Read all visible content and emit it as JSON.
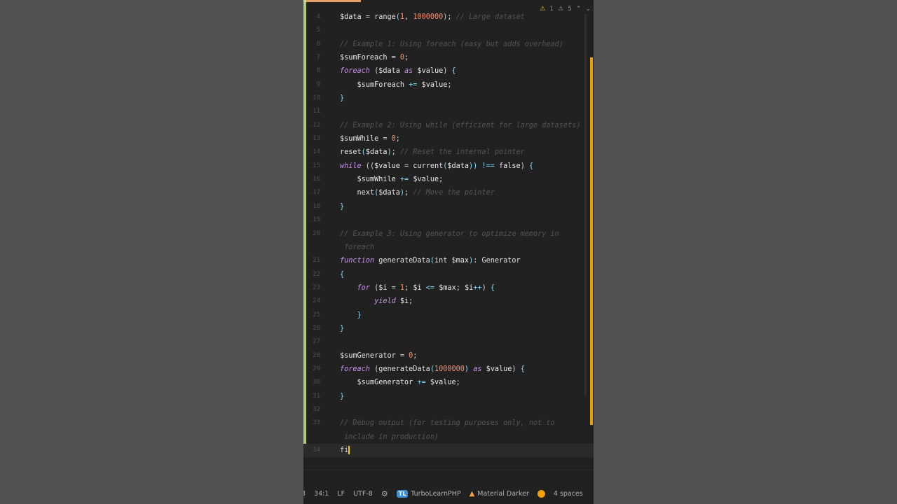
{
  "inspection": {
    "warnings": "1",
    "weak_warnings": "5",
    "up_arrow": "⌃",
    "down_arrow": "⌄"
  },
  "code_lines": [
    {
      "n": "4",
      "tokens": [
        [
          "var",
          "$data"
        ],
        [
          "plain",
          " = "
        ],
        [
          "fn",
          "range"
        ],
        [
          "punc",
          "("
        ],
        [
          "num",
          "1"
        ],
        [
          "plain",
          ", "
        ],
        [
          "num",
          "1000000"
        ],
        [
          "punc",
          ")"
        ],
        [
          "plain",
          "; "
        ],
        [
          "cm",
          "// Large dataset"
        ]
      ]
    },
    {
      "n": "5",
      "tokens": []
    },
    {
      "n": "6",
      "tokens": [
        [
          "cm",
          "// Example 1: Using foreach (easy but adds overhead)"
        ]
      ]
    },
    {
      "n": "7",
      "tokens": [
        [
          "var",
          "$sumForeach"
        ],
        [
          "plain",
          " = "
        ],
        [
          "num",
          "0"
        ],
        [
          "plain",
          ";"
        ]
      ]
    },
    {
      "n": "8",
      "tokens": [
        [
          "kw",
          "foreach"
        ],
        [
          "plain",
          " ("
        ],
        [
          "var",
          "$data"
        ],
        [
          "plain",
          " "
        ],
        [
          "kw",
          "as"
        ],
        [
          "plain",
          " "
        ],
        [
          "var",
          "$value"
        ],
        [
          "plain",
          ") "
        ],
        [
          "punc",
          "{"
        ]
      ]
    },
    {
      "n": "9",
      "tokens": [
        [
          "plain",
          "    "
        ],
        [
          "var",
          "$sumForeach"
        ],
        [
          "plain",
          " "
        ],
        [
          "op",
          "+="
        ],
        [
          "plain",
          " "
        ],
        [
          "var",
          "$value"
        ],
        [
          "plain",
          ";"
        ]
      ]
    },
    {
      "n": "10",
      "tokens": [
        [
          "punc",
          "}"
        ]
      ]
    },
    {
      "n": "11",
      "tokens": []
    },
    {
      "n": "12",
      "tokens": [
        [
          "cm",
          "// Example 2: Using while (efficient for large datasets)"
        ]
      ]
    },
    {
      "n": "13",
      "tokens": [
        [
          "var",
          "$sumWhile"
        ],
        [
          "plain",
          " = "
        ],
        [
          "num",
          "0"
        ],
        [
          "plain",
          ";"
        ]
      ]
    },
    {
      "n": "14",
      "tokens": [
        [
          "fn",
          "reset"
        ],
        [
          "punc",
          "("
        ],
        [
          "var",
          "$data"
        ],
        [
          "punc",
          ")"
        ],
        [
          "plain",
          "; "
        ],
        [
          "cm",
          "// Reset the internal pointer"
        ]
      ]
    },
    {
      "n": "15",
      "tokens": [
        [
          "kw",
          "while"
        ],
        [
          "plain",
          " (("
        ],
        [
          "var",
          "$value"
        ],
        [
          "plain",
          " = "
        ],
        [
          "fn",
          "current"
        ],
        [
          "punc",
          "("
        ],
        [
          "var",
          "$data"
        ],
        [
          "punc",
          "))"
        ],
        [
          "plain",
          " "
        ],
        [
          "op",
          "!=="
        ],
        [
          "plain",
          " "
        ],
        [
          "bool",
          "false"
        ],
        [
          "plain",
          ") "
        ],
        [
          "punc",
          "{"
        ]
      ]
    },
    {
      "n": "16",
      "tokens": [
        [
          "plain",
          "    "
        ],
        [
          "var",
          "$sumWhile"
        ],
        [
          "plain",
          " "
        ],
        [
          "op",
          "+="
        ],
        [
          "plain",
          " "
        ],
        [
          "var",
          "$value"
        ],
        [
          "plain",
          ";"
        ]
      ]
    },
    {
      "n": "17",
      "tokens": [
        [
          "plain",
          "    "
        ],
        [
          "fn",
          "next"
        ],
        [
          "punc",
          "("
        ],
        [
          "var",
          "$data"
        ],
        [
          "punc",
          ")"
        ],
        [
          "plain",
          "; "
        ],
        [
          "cm",
          "// Move the pointer"
        ]
      ]
    },
    {
      "n": "18",
      "tokens": [
        [
          "punc",
          "}"
        ]
      ]
    },
    {
      "n": "19",
      "tokens": []
    },
    {
      "n": "20",
      "tokens": [
        [
          "cm",
          "// Example 3: Using generator to optimize memory in"
        ]
      ]
    },
    {
      "n": "",
      "tokens": [
        [
          "cm",
          " foreach"
        ]
      ]
    },
    {
      "n": "21",
      "tokens": [
        [
          "kw",
          "function"
        ],
        [
          "plain",
          " "
        ],
        [
          "fn",
          "generateData"
        ],
        [
          "punc",
          "("
        ],
        [
          "ty",
          "int"
        ],
        [
          "plain",
          " "
        ],
        [
          "var",
          "$max"
        ],
        [
          "punc",
          ")"
        ],
        [
          "plain",
          ": "
        ],
        [
          "ty",
          "Generator"
        ]
      ]
    },
    {
      "n": "22",
      "tokens": [
        [
          "punc",
          "{"
        ]
      ]
    },
    {
      "n": "23",
      "tokens": [
        [
          "plain",
          "    "
        ],
        [
          "kw",
          "for"
        ],
        [
          "plain",
          " ("
        ],
        [
          "var",
          "$i"
        ],
        [
          "plain",
          " = "
        ],
        [
          "num",
          "1"
        ],
        [
          "plain",
          "; "
        ],
        [
          "var",
          "$i"
        ],
        [
          "plain",
          " "
        ],
        [
          "op",
          "<="
        ],
        [
          "plain",
          " "
        ],
        [
          "var",
          "$max"
        ],
        [
          "plain",
          "; "
        ],
        [
          "var",
          "$i"
        ],
        [
          "op",
          "++"
        ],
        [
          "plain",
          ") "
        ],
        [
          "punc",
          "{"
        ]
      ]
    },
    {
      "n": "24",
      "tokens": [
        [
          "plain",
          "        "
        ],
        [
          "kw",
          "yield"
        ],
        [
          "plain",
          " "
        ],
        [
          "var",
          "$i"
        ],
        [
          "plain",
          ";"
        ]
      ]
    },
    {
      "n": "25",
      "tokens": [
        [
          "plain",
          "    "
        ],
        [
          "punc",
          "}"
        ]
      ]
    },
    {
      "n": "26",
      "tokens": [
        [
          "punc",
          "}"
        ]
      ]
    },
    {
      "n": "27",
      "tokens": []
    },
    {
      "n": "28",
      "tokens": [
        [
          "var",
          "$sumGenerator"
        ],
        [
          "plain",
          " = "
        ],
        [
          "num",
          "0"
        ],
        [
          "plain",
          ";"
        ]
      ]
    },
    {
      "n": "29",
      "tokens": [
        [
          "kw",
          "foreach"
        ],
        [
          "plain",
          " ("
        ],
        [
          "fn",
          "generateData"
        ],
        [
          "punc",
          "("
        ],
        [
          "num",
          "1000000"
        ],
        [
          "punc",
          ")"
        ],
        [
          "plain",
          " "
        ],
        [
          "kw",
          "as"
        ],
        [
          "plain",
          " "
        ],
        [
          "var",
          "$value"
        ],
        [
          "plain",
          ") "
        ],
        [
          "punc",
          "{"
        ]
      ]
    },
    {
      "n": "30",
      "tokens": [
        [
          "plain",
          "    "
        ],
        [
          "var",
          "$sumGenerator"
        ],
        [
          "plain",
          " "
        ],
        [
          "op",
          "+="
        ],
        [
          "plain",
          " "
        ],
        [
          "var",
          "$value"
        ],
        [
          "plain",
          ";"
        ]
      ]
    },
    {
      "n": "31",
      "tokens": [
        [
          "punc",
          "}"
        ]
      ]
    },
    {
      "n": "32",
      "tokens": []
    },
    {
      "n": "33",
      "tokens": [
        [
          "cm",
          "// Debug output (for testing purposes only, not to"
        ]
      ]
    },
    {
      "n": "",
      "tokens": [
        [
          "cm",
          " include in production)"
        ]
      ]
    },
    {
      "n": "34",
      "tokens": [
        [
          "plain",
          "fi"
        ]
      ],
      "current": true
    }
  ],
  "status": {
    "partial": "3",
    "position": "34:1",
    "line_sep": "LF",
    "encoding": "UTF-8",
    "plugin_badge": "TL",
    "plugin": "TurboLearnPHP",
    "theme": "Material Darker",
    "indent": "4 spaces"
  }
}
